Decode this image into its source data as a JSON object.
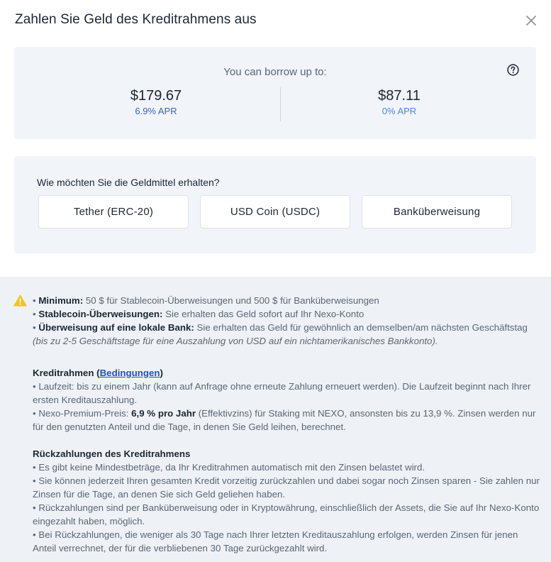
{
  "dialog": {
    "title": "Zahlen Sie Geld des Kreditrahmens aus",
    "close_icon": "close-icon"
  },
  "borrow": {
    "label": "You can borrow up to:",
    "left_amount": "$179.67",
    "left_apr": "6.9% APR",
    "right_amount": "$87.11",
    "right_apr": "0% APR",
    "help_icon": "help-circle-icon"
  },
  "method": {
    "question": "Wie möchten Sie die Geldmittel erhalten?",
    "options": [
      "Tether (ERC-20)",
      "USD Coin (USDC)",
      "Banküberweisung"
    ]
  },
  "info": {
    "warning_icon": "warning-icon",
    "bullets": {
      "b1_label": "Minimum:",
      "b1_text": " 50 $ für Stablecoin-Überweisungen und 500 $ für Banküberweisungen",
      "b2_label": "Stablecoin-Überweisungen:",
      "b2_text": " Sie erhalten das Geld sofort auf Ihr Nexo-Konto",
      "b3_label": "Überweisung auf eine lokale Bank:",
      "b3_text": " Sie erhalten das Geld für gewöhnlich an demselben/am nächsten Geschäftstag ",
      "b3_italic": "(bis zu 2-5 Geschäftstage für eine Auszahlung von USD auf ein nichtamerikanisches Bankkonto)."
    },
    "credit": {
      "title_start": "Kreditrahmen (",
      "link": "Bedingungen",
      "title_end": ")",
      "line1": "• Laufzeit: bis zu einem Jahr (kann auf Anfrage ohne erneute Zahlung erneuert werden). Die Laufzeit beginnt nach Ihrer ersten Kreditauszahlung.",
      "line2_start": "• Nexo-Premium-Preis: ",
      "line2_bold": "6,9 % pro Jahr",
      "line2_end": " (Effektivzins) für Staking mit NEXO, ansonsten bis zu 13,9 %. Zinsen werden nur für den genutzten Anteil und die Tage, in denen Sie Geld leihen, berechnet."
    },
    "repay": {
      "title": "Rückzahlungen des Kreditrahmens",
      "l1": "• Es gibt keine Mindestbeträge, da Ihr Kreditrahmen automatisch mit den Zinsen belastet wird.",
      "l2": "• Sie können jederzeit Ihren gesamten Kredit vorzeitig zurückzahlen und dabei sogar noch Zinsen sparen - Sie zahlen nur Zinsen für die Tage, an denen Sie sich Geld geliehen haben.",
      "l3": "• Rückzahlungen sind per Banküberweisung oder in Kryptowährung, einschließlich der Assets, die Sie auf Ihr Nexo-Konto eingezahlt haben, möglich.",
      "l4": "• Bei Rückzahlungen, die weniger als 30 Tage nach Ihrer letzten Kreditauszahlung erfolgen, werden Zinsen für jenen Anteil verrechnet, der für die verbliebenen 30 Tage zurückgezahlt wird."
    }
  },
  "colors": {
    "accent": "#3a64b7",
    "link": "#2350b8",
    "warning": "#f5c518",
    "card_bg": "#f1f4f9"
  }
}
